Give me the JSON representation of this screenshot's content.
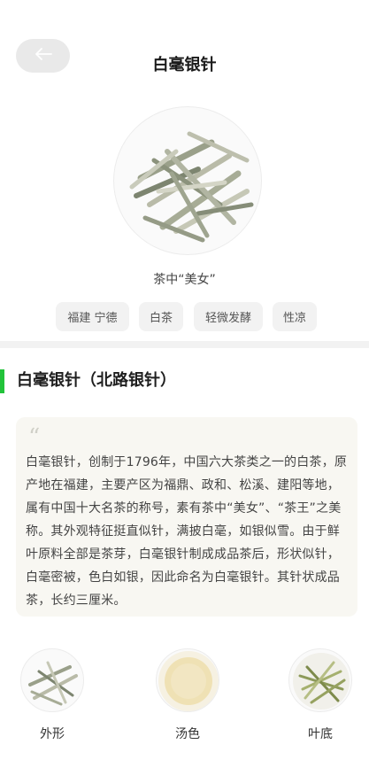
{
  "header": {
    "title": "白毫银针",
    "back_icon": "arrow-left-icon"
  },
  "hero": {
    "image": "tea-leaves-image",
    "subtitle": "茶中“美女”"
  },
  "tags": [
    "福建 宁德",
    "白茶",
    "轻微发酵",
    "性凉"
  ],
  "section": {
    "title": "白毫银针（北路银针）",
    "accent_color": "#22c33a",
    "quote_icon": "quote-icon",
    "description": "白毫银针，创制于1796年，中国六大茶类之一的白茶，原产地在福建，主要产区为福鼎、政和、松溪、建阳等地，属有中国十大名茶的称号，素有茶中“美女”、“茶王”之美称。其外观特征挺直似针，满披白毫，如银似雪。由于鲜叶原料全部是茶芽，白毫银针制成成品茶后，形状似针，白毫密被，色白如银，因此命名为白毫银针。其针状成品茶，长约三厘米。"
  },
  "thumbnails": [
    {
      "label": "外形",
      "image": "dry-leaf-image"
    },
    {
      "label": "汤色",
      "image": "tea-liquor-image"
    },
    {
      "label": "叶底",
      "image": "brewed-leaf-image"
    }
  ]
}
